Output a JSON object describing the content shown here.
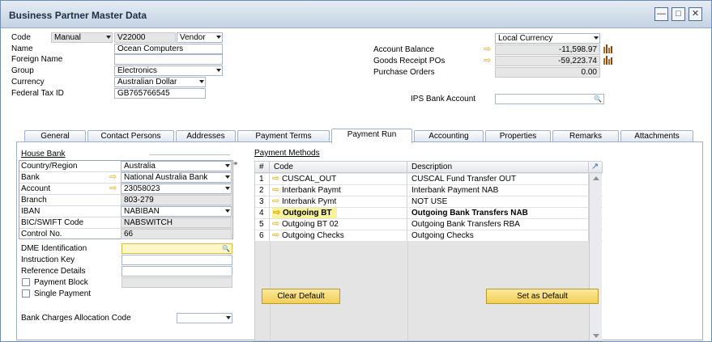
{
  "window": {
    "title": "Business Partner Master Data"
  },
  "header": {
    "code_label": "Code",
    "code_mode": "Manual",
    "code_value": "V22000",
    "bp_type": "Vendor",
    "name_label": "Name",
    "name_value": "Ocean Computers",
    "foreign_name_label": "Foreign Name",
    "foreign_name_value": "",
    "group_label": "Group",
    "group_value": "Electronics",
    "currency_label": "Currency",
    "currency_value": "Australian Dollar",
    "tax_label": "Federal Tax ID",
    "tax_value": "GB765766545",
    "local_currency": "Local Currency",
    "account_balance_label": "Account Balance",
    "account_balance_value": "-11,598.97",
    "goods_receipt_label": "Goods Receipt POs",
    "goods_receipt_value": "-59,223.74",
    "purchase_orders_label": "Purchase Orders",
    "purchase_orders_value": "0.00",
    "ips_label": "IPS Bank Account",
    "ips_value": ""
  },
  "tabs": [
    "General",
    "Contact Persons",
    "Addresses",
    "Payment Terms",
    "Payment Run",
    "Accounting",
    "Properties",
    "Remarks",
    "Attachments"
  ],
  "active_tab": "Payment Run",
  "house_bank": {
    "title": "House Bank",
    "rows": [
      {
        "label": "Country/Region",
        "value": "Australia"
      },
      {
        "label": "Bank",
        "value": "National Australia Bank"
      },
      {
        "label": "Account",
        "value": "23058023"
      },
      {
        "label": "Branch",
        "value": "803-279"
      },
      {
        "label": "IBAN",
        "value": "NABIBAN"
      },
      {
        "label": "BIC/SWIFT Code",
        "value": "NABSWITCH"
      },
      {
        "label": "Control No.",
        "value": "66"
      }
    ]
  },
  "form": {
    "dme_label": "DME Identification",
    "instruction_label": "Instruction Key",
    "reference_label": "Reference Details",
    "payment_block_label": "Payment Block",
    "single_payment_label": "Single Payment",
    "bank_charges_label": "Bank Charges Allocation Code"
  },
  "payment_methods": {
    "title": "Payment Methods",
    "headers": {
      "num": "#",
      "code": "Code",
      "description": "Description"
    },
    "rows": [
      {
        "num": "1",
        "code": "CUSCAL_OUT",
        "description": "CUSCAL Fund Transfer OUT"
      },
      {
        "num": "2",
        "code": "Interbank Paymt",
        "description": "Interbank Payment NAB"
      },
      {
        "num": "3",
        "code": "Interbank Pymt",
        "description": "NOT USE"
      },
      {
        "num": "4",
        "code": "Outgoing BT",
        "description": "Outgoing Bank Transfers NAB"
      },
      {
        "num": "5",
        "code": "Outgoing BT 02",
        "description": "Outgoing Bank Transfers RBA"
      },
      {
        "num": "6",
        "code": "Outgoing Checks",
        "description": "Outgoing Checks"
      }
    ],
    "selected_row": "4"
  },
  "buttons": {
    "clear_default": "Clear Default",
    "set_as_default": "Set as Default"
  },
  "colors": {
    "accent_yellow": "#f2cf55",
    "link_arrow": "#e6a800",
    "selected_row": "#f8f39a"
  }
}
